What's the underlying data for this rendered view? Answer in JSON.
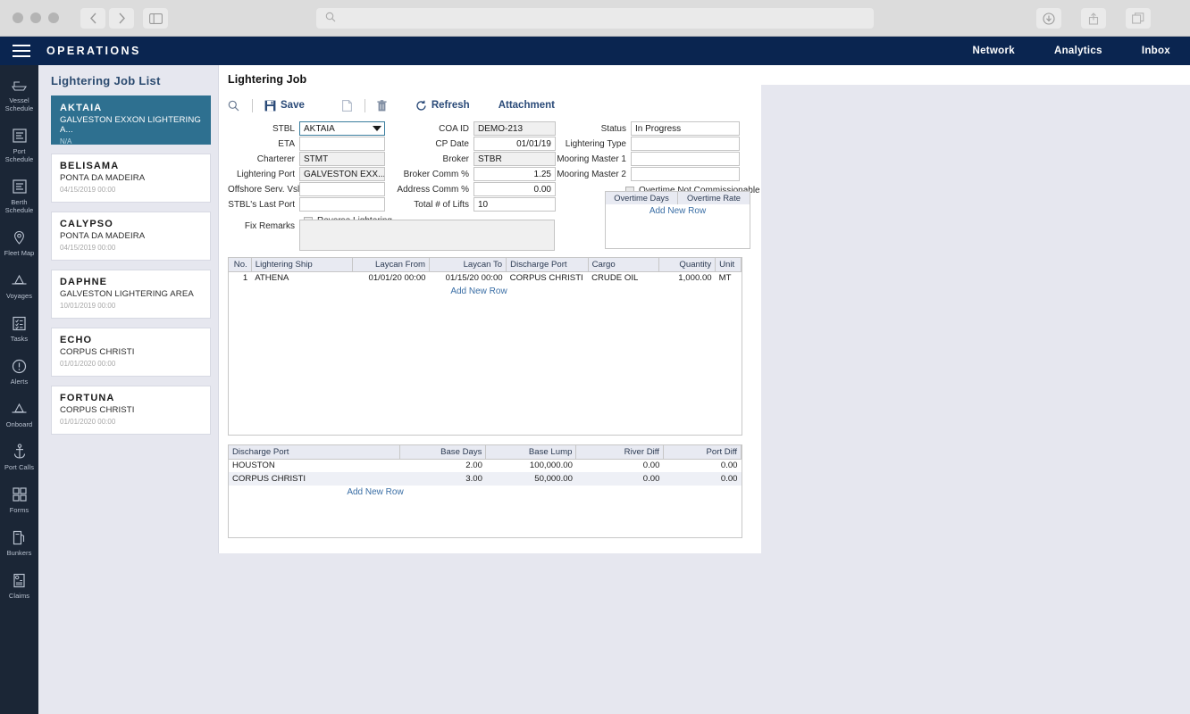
{
  "browser": {
    "search_placeholder": "",
    "icons": [
      "back-icon",
      "forward-icon",
      "sidebar-icon",
      "search-icon",
      "download-icon",
      "share-icon",
      "tabs-icon"
    ]
  },
  "header": {
    "title": "OPERATIONS",
    "nav": [
      {
        "label": "Network"
      },
      {
        "label": "Analytics"
      },
      {
        "label": "Inbox"
      }
    ]
  },
  "rail": {
    "items": [
      {
        "label": "Vessel\nSchedule",
        "icon": "vessel-schedule-icon"
      },
      {
        "label": "Port\nSchedule",
        "icon": "port-schedule-icon"
      },
      {
        "label": "Berth\nSchedule",
        "icon": "berth-schedule-icon"
      },
      {
        "label": "Fleet Map",
        "icon": "fleet-map-icon"
      },
      {
        "label": "Voyages",
        "icon": "voyages-icon"
      },
      {
        "label": "Tasks",
        "icon": "tasks-icon"
      },
      {
        "label": "Alerts",
        "icon": "alerts-icon"
      },
      {
        "label": "Onboard",
        "icon": "onboard-icon"
      },
      {
        "label": "Port Calls",
        "icon": "port-calls-icon"
      },
      {
        "label": "Forms",
        "icon": "forms-icon"
      },
      {
        "label": "Bunkers",
        "icon": "bunkers-icon"
      },
      {
        "label": "Claims",
        "icon": "claims-icon"
      }
    ]
  },
  "joblist": {
    "title": "Lightering Job List",
    "items": [
      {
        "name": "AKTAIA",
        "port": "GALVESTON EXXON LIGHTERING A...",
        "date": "N/A",
        "selected": true
      },
      {
        "name": "BELISAMA",
        "port": "PONTA DA MADEIRA",
        "date": "04/15/2019 00:00",
        "selected": false
      },
      {
        "name": "CALYPSO",
        "port": "PONTA DA MADEIRA",
        "date": "04/15/2019 00:00",
        "selected": false
      },
      {
        "name": "DAPHNE",
        "port": "GALVESTON LIGHTERING AREA",
        "date": "10/01/2019 00:00",
        "selected": false
      },
      {
        "name": "ECHO",
        "port": "CORPUS CHRISTI",
        "date": "01/01/2020 00:00",
        "selected": false
      },
      {
        "name": "FORTUNA",
        "port": "CORPUS CHRISTI",
        "date": "01/01/2020 00:00",
        "selected": false
      }
    ]
  },
  "main": {
    "page_title": "Lightering Job",
    "toolbar": {
      "search_icon": "search-icon",
      "save_label": "Save",
      "copy_icon": "copy-icon",
      "delete_icon": "trash-icon",
      "refresh_label": "Refresh",
      "attachment_label": "Attachment"
    },
    "form": {
      "col1": [
        {
          "label": "STBL",
          "value": "AKTAIA",
          "type": "dropdown"
        },
        {
          "label": "ETA",
          "value": "",
          "type": "text"
        },
        {
          "label": "Charterer",
          "value": "STMT",
          "type": "readonly"
        },
        {
          "label": "Lightering Port",
          "value": "GALVESTON EXX...",
          "type": "readonly"
        },
        {
          "label": "Offshore Serv. Vsl.",
          "value": "",
          "type": "text"
        },
        {
          "label": "STBL's Last Port",
          "value": "",
          "type": "text"
        }
      ],
      "reverse_lightering": {
        "label": "Reverse Lightering",
        "checked": false
      },
      "fix_remarks": {
        "label": "Fix Remarks",
        "value": ""
      },
      "col2": [
        {
          "label": "COA ID",
          "value": "DEMO-213",
          "type": "readonly"
        },
        {
          "label": "CP Date",
          "value": "01/01/19",
          "type": "number"
        },
        {
          "label": "Broker",
          "value": "STBR",
          "type": "readonly"
        },
        {
          "label": "Broker Comm %",
          "value": "1.25",
          "type": "number"
        },
        {
          "label": "Address Comm %",
          "value": "0.00",
          "type": "number"
        },
        {
          "label": "Total # of Lifts",
          "value": "10",
          "type": "text"
        }
      ],
      "col3": [
        {
          "label": "Status",
          "value": "In Progress",
          "type": "text"
        },
        {
          "label": "Lightering Type",
          "value": "",
          "type": "text"
        },
        {
          "label": "Mooring Master 1",
          "value": "",
          "type": "text"
        },
        {
          "label": "Mooring Master 2",
          "value": "",
          "type": "text"
        }
      ],
      "overtime_checkbox": {
        "label": "Overtime Not Commissionable",
        "checked": false
      },
      "overtime_grid": {
        "columns": [
          "Overtime Days",
          "Overtime Rate"
        ],
        "rows": [],
        "add_row_label": "Add New Row"
      }
    },
    "grid1": {
      "columns": [
        "No.",
        "Lightering Ship",
        "Laycan From",
        "Laycan To",
        "Discharge Port",
        "Cargo",
        "Quantity",
        "Unit"
      ],
      "rows": [
        {
          "no": "1",
          "ship": "ATHENA",
          "laycan_from": "01/01/20 00:00",
          "laycan_to": "01/15/20 00:00",
          "discharge_port": "CORPUS CHRISTI",
          "cargo": "CRUDE OIL",
          "quantity": "1,000.00",
          "unit": "MT"
        }
      ],
      "add_row_label": "Add New Row"
    },
    "grid2": {
      "columns": [
        "Discharge Port",
        "Base Days",
        "Base Lump",
        "River Diff",
        "Port Diff"
      ],
      "rows": [
        {
          "port": "HOUSTON",
          "base_days": "2.00",
          "base_lump": "100,000.00",
          "river_diff": "0.00",
          "port_diff": "0.00"
        },
        {
          "port": "CORPUS CHRISTI",
          "base_days": "3.00",
          "base_lump": "50,000.00",
          "river_diff": "0.00",
          "port_diff": "0.00"
        }
      ],
      "add_row_label": "Add New Row"
    }
  },
  "colors": {
    "header_navy": "#0a2550",
    "rail_dark": "#1b2636",
    "selected_teal": "#2e7090",
    "panel_grey": "#e6e7ef",
    "link_blue": "#3a6ea5"
  }
}
